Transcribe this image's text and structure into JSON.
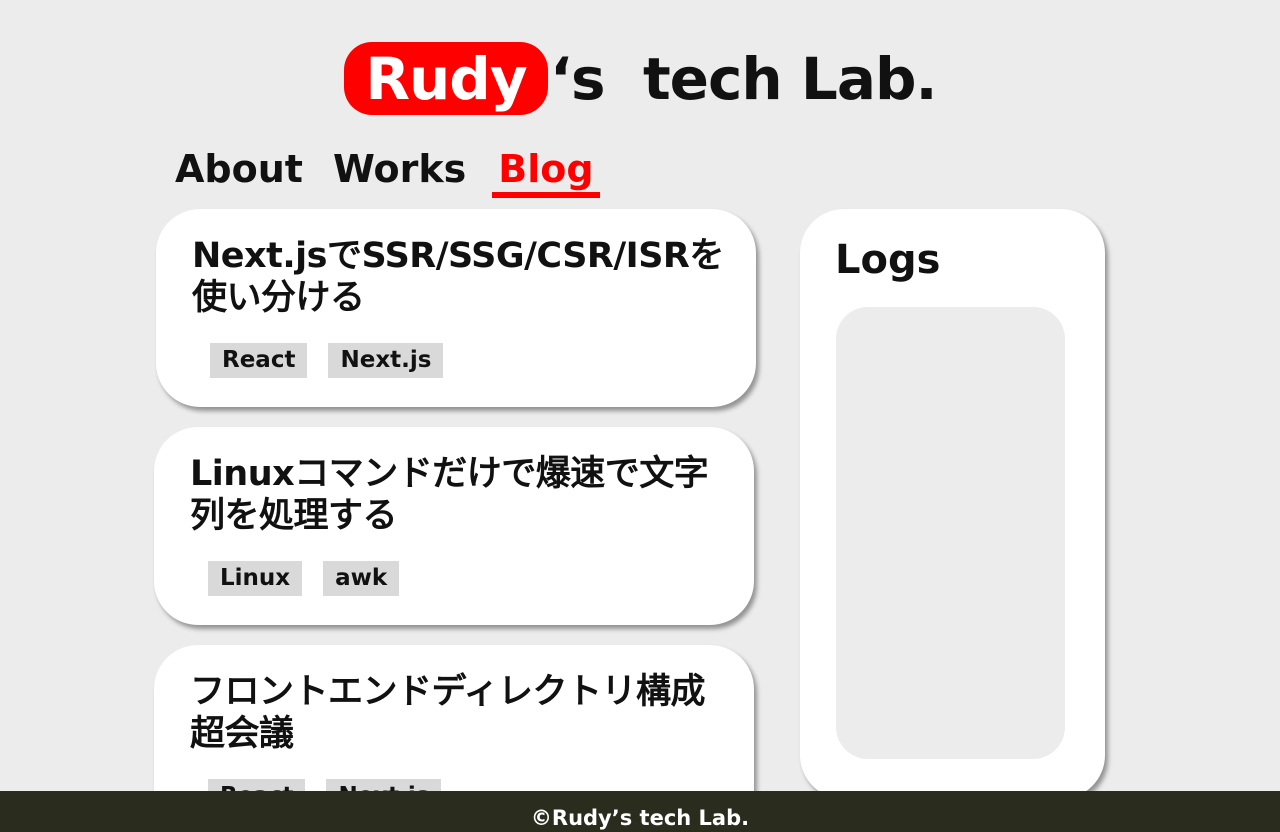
{
  "logo": {
    "highlight": "Rudy",
    "rest": "‘s  tech Lab."
  },
  "nav": [
    {
      "label": "About",
      "active": false
    },
    {
      "label": "Works",
      "active": false
    },
    {
      "label": "Blog",
      "active": true
    }
  ],
  "posts": [
    {
      "title": "Next.jsでSSR/SSG/CSR/ISRを使い分ける",
      "tags": [
        "React",
        "Next.js"
      ]
    },
    {
      "title": "Linuxコマンドだけで爆速で文字列を処理する",
      "tags": [
        "Linux",
        "awk"
      ]
    },
    {
      "title": "フロントエンドディレクトリ構成超会議",
      "tags": [
        "React",
        "Next.js"
      ]
    }
  ],
  "logs": {
    "title": "Logs"
  },
  "footer": {
    "copyright": "©Rudy’s tech Lab."
  },
  "colors": {
    "accent": "#fe0000",
    "background": "#ececec",
    "footer": "#2a2c1e"
  }
}
